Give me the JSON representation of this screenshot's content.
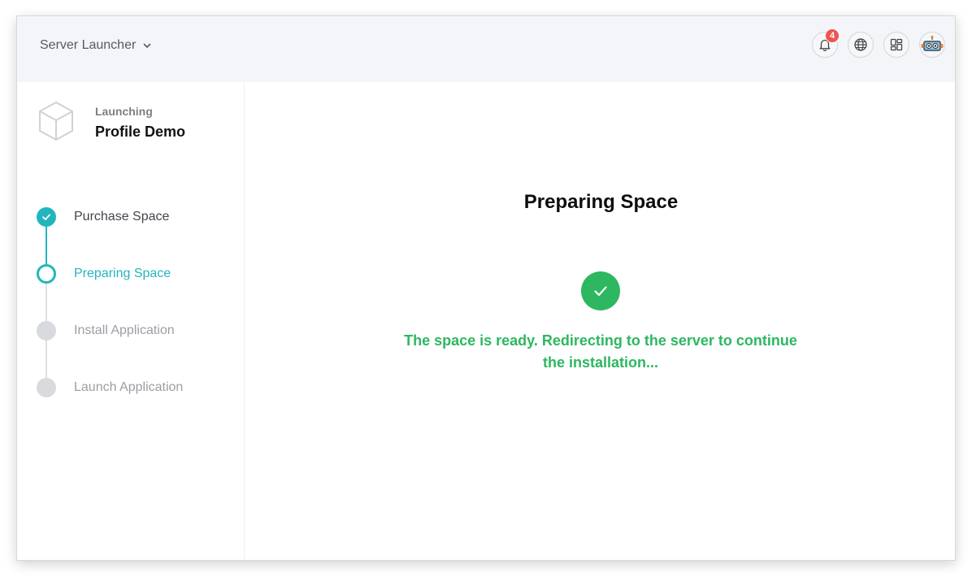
{
  "header": {
    "app_switcher_label": "Server Launcher",
    "notifications_count": "4"
  },
  "project": {
    "kicker": "Launching",
    "name": "Profile Demo"
  },
  "steps": [
    {
      "label": "Purchase Space",
      "state": "complete"
    },
    {
      "label": "Preparing Space",
      "state": "current"
    },
    {
      "label": "Install Application",
      "state": "pending"
    },
    {
      "label": "Launch Application",
      "state": "pending"
    }
  ],
  "main": {
    "title": "Preparing Space",
    "status_message": "The space is ready. Redirecting to the server to continue the installation..."
  },
  "colors": {
    "accent": "#23b5bd",
    "success": "#2db760",
    "badge": "#f05451",
    "pending": "#d8dadd"
  },
  "icons": {
    "dropdown": "chevron-down-icon",
    "notifications": "bell-icon",
    "language": "globe-icon",
    "apps": "grid-icon",
    "profile": "robot-avatar-icon",
    "project": "cube-icon",
    "step_complete": "check-icon",
    "status": "success-check-icon"
  }
}
